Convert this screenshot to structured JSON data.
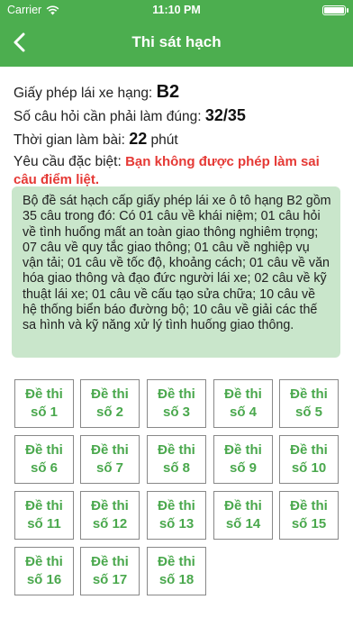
{
  "status_bar": {
    "carrier": "Carrier",
    "time": "11:10 PM",
    "battery_level": 1.0
  },
  "navbar": {
    "title": "Thi sát hạch",
    "back_icon": "chevron-left-icon"
  },
  "info": {
    "license_label": "Giấy phép lái xe hạng:",
    "license_value": "B2",
    "required_label": "Số câu hỏi cần phải làm đúng:",
    "required_value": "32/35",
    "time_label": "Thời gian làm bài:",
    "time_value": "22",
    "time_unit": "phút",
    "special_label": "Yêu cầu đặc biệt:",
    "special_value": "Bạn không được phép làm sai câu điểm liệt."
  },
  "description": "Bộ đề sát hạch cấp giấy phép lái xe ô tô hạng B2 gồm 35 câu trong đó: Có 01 câu về khái niệm; 01 câu hỏi về tình huống mất an toàn giao thông nghiêm trọng; 07 câu về quy tắc giao thông; 01 câu về nghiệp vụ vận tải; 01 câu về tốc độ, khoảng cách; 01 câu về văn hóa giao thông và đạo đức người lái xe; 02 câu về kỹ thuật lái xe; 01 câu về cấu tạo sửa chữa; 10 câu về hệ thống biển báo đường bộ; 10 câu về giải các thế sa hình và kỹ năng xử lý tình huống giao thông.",
  "exams": [
    {
      "line1": "Đề thi",
      "line2": "số 1"
    },
    {
      "line1": "Đề thi",
      "line2": "số 2"
    },
    {
      "line1": "Đề thi",
      "line2": "số 3"
    },
    {
      "line1": "Đề thi",
      "line2": "số 4"
    },
    {
      "line1": "Đề thi",
      "line2": "số 5"
    },
    {
      "line1": "Đề thi",
      "line2": "số 6"
    },
    {
      "line1": "Đề thi",
      "line2": "số 7"
    },
    {
      "line1": "Đề thi",
      "line2": "số 8"
    },
    {
      "line1": "Đề thi",
      "line2": "số 9"
    },
    {
      "line1": "Đề thi",
      "line2": "số 10"
    },
    {
      "line1": "Đề thi",
      "line2": "số 11"
    },
    {
      "line1": "Đề thi",
      "line2": "số 12"
    },
    {
      "line1": "Đề thi",
      "line2": "số 13"
    },
    {
      "line1": "Đề thi",
      "line2": "số 14"
    },
    {
      "line1": "Đề thi",
      "line2": "số 15"
    },
    {
      "line1": "Đề thi",
      "line2": "số 16"
    },
    {
      "line1": "Đề thi",
      "line2": "số 17"
    },
    {
      "line1": "Đề thi",
      "line2": "số 18"
    }
  ],
  "colors": {
    "header": "#4cae4f",
    "accent_text": "#4aa84d",
    "warning": "#e53935",
    "panel": "#c9e6cb"
  }
}
